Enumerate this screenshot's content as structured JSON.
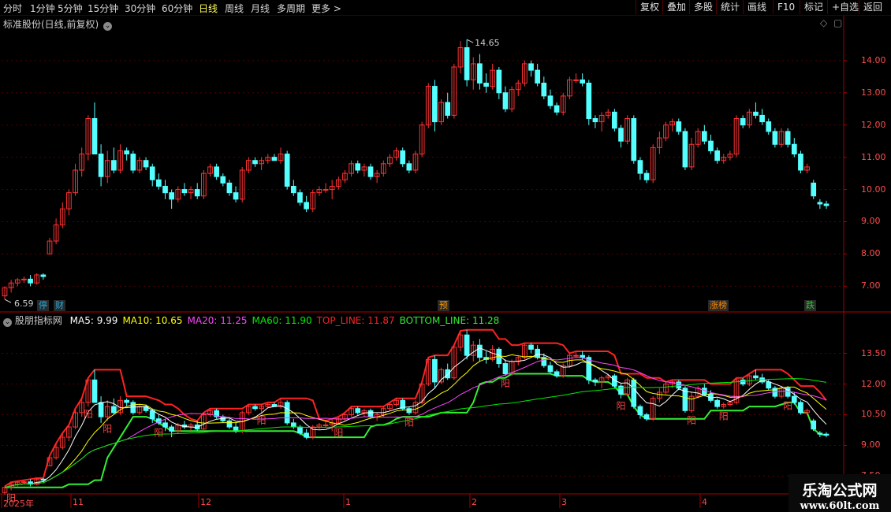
{
  "toolbar": {
    "periods": [
      "分时",
      "1分钟",
      "5分钟",
      "15分钟",
      "30分钟",
      "60分钟",
      "日线",
      "周线",
      "月线",
      "多周期",
      "更多 >"
    ],
    "active_period": "日线",
    "right_buttons": [
      "复权",
      "叠加",
      "多股",
      "统计",
      "画线",
      "F10",
      "标记",
      "+自选",
      "返回"
    ]
  },
  "main_chart": {
    "title": "标准股份(日线,前复权)",
    "high_marker": "14.65",
    "low_marker": "6.59",
    "y_ticks": [
      "14.00",
      "13.00",
      "12.00",
      "11.00",
      "10.00",
      "9.00",
      "8.00",
      "7.00"
    ],
    "events": [
      {
        "label": "停",
        "color": "#22aadd"
      },
      {
        "label": "财",
        "color": "#22aadd"
      },
      {
        "label": "预",
        "color": "#ff9900"
      },
      {
        "label": "涨榜",
        "color": "#ff8800"
      },
      {
        "label": "跌",
        "color": "#22cc22"
      }
    ]
  },
  "indicator": {
    "title": "股朋指标网",
    "values": [
      {
        "label": "MA5: 9.99",
        "color": "#ffffff"
      },
      {
        "label": "MA10: 10.65",
        "color": "#ffff00"
      },
      {
        "label": "MA20: 11.25",
        "color": "#ff44ff"
      },
      {
        "label": "MA60: 11.90",
        "color": "#00ee00"
      },
      {
        "label": "TOP_LINE: 11.87",
        "color": "#ff2222"
      },
      {
        "label": "BOTTOM_LINE: 11.28",
        "color": "#33ee33"
      }
    ],
    "y_ticks": [
      "13.50",
      "12.00",
      "10.50",
      "9.00",
      "7.50"
    ],
    "marker_text": "阳"
  },
  "x_axis": {
    "labels": [
      "2025年",
      "11",
      "12",
      "1",
      "2",
      "3",
      "4"
    ]
  },
  "watermark": {
    "name": "乐淘公式网",
    "url": "www.60lt.com"
  },
  "colors": {
    "up": "#ff3333",
    "down": "#54ffff",
    "axis": "#aa0000",
    "grid": "#550000"
  },
  "chart_data": {
    "type": "candlestick",
    "ylim": [
      6.3,
      14.9
    ],
    "candles_ohlc": [
      [
        6.7,
        7.0,
        6.59,
        6.95
      ],
      [
        6.95,
        7.2,
        6.8,
        7.1
      ],
      [
        7.1,
        7.25,
        7.0,
        7.2
      ],
      [
        7.2,
        7.3,
        7.1,
        7.22
      ],
      [
        7.22,
        7.35,
        7.0,
        7.1
      ],
      [
        7.1,
        7.4,
        7.05,
        7.35
      ],
      [
        7.35,
        7.4,
        7.2,
        7.3
      ],
      [
        8.0,
        8.5,
        8.0,
        8.4
      ],
      [
        8.4,
        9.1,
        8.3,
        8.9
      ],
      [
        8.9,
        9.6,
        8.8,
        9.4
      ],
      [
        9.4,
        10.0,
        9.2,
        9.9
      ],
      [
        9.9,
        10.8,
        9.8,
        10.6
      ],
      [
        10.6,
        11.3,
        10.4,
        11.1
      ],
      [
        11.1,
        12.3,
        10.9,
        12.2
      ],
      [
        12.2,
        12.7,
        11.1,
        11.1
      ],
      [
        11.1,
        11.4,
        10.1,
        10.4
      ],
      [
        10.4,
        11.2,
        10.2,
        10.9
      ],
      [
        10.9,
        11.3,
        10.5,
        10.6
      ],
      [
        10.6,
        11.4,
        10.5,
        11.2
      ],
      [
        11.2,
        11.3,
        10.9,
        11.1
      ],
      [
        11.1,
        11.2,
        10.5,
        10.6
      ],
      [
        10.6,
        11.0,
        10.5,
        10.9
      ],
      [
        10.9,
        11.0,
        10.6,
        10.7
      ],
      [
        10.7,
        10.8,
        10.1,
        10.3
      ],
      [
        10.3,
        10.5,
        10.0,
        10.1
      ],
      [
        10.1,
        10.3,
        9.7,
        9.9
      ],
      [
        9.9,
        10.0,
        9.4,
        9.7
      ],
      [
        9.7,
        10.1,
        9.6,
        10.0
      ],
      [
        10.0,
        10.2,
        9.8,
        9.9
      ],
      [
        9.9,
        10.1,
        9.7,
        10.0
      ],
      [
        10.0,
        10.2,
        9.7,
        9.8
      ],
      [
        9.8,
        10.6,
        9.7,
        10.5
      ],
      [
        10.5,
        10.8,
        10.4,
        10.7
      ],
      [
        10.7,
        10.8,
        10.3,
        10.4
      ],
      [
        10.4,
        10.5,
        10.1,
        10.2
      ],
      [
        10.2,
        10.3,
        9.8,
        9.9
      ],
      [
        9.9,
        10.1,
        9.6,
        9.7
      ],
      [
        9.7,
        10.7,
        9.6,
        10.6
      ],
      [
        10.6,
        11.0,
        10.5,
        10.9
      ],
      [
        10.9,
        11.0,
        10.7,
        10.8
      ],
      [
        10.8,
        11.0,
        10.6,
        10.9
      ],
      [
        10.9,
        11.1,
        10.8,
        11.0
      ],
      [
        11.0,
        11.1,
        10.9,
        10.9
      ],
      [
        10.9,
        11.3,
        10.8,
        11.1
      ],
      [
        11.1,
        11.2,
        10.0,
        10.1
      ],
      [
        10.1,
        10.3,
        9.8,
        9.9
      ],
      [
        9.9,
        10.0,
        9.5,
        9.6
      ],
      [
        9.6,
        9.8,
        9.3,
        9.4
      ],
      [
        9.4,
        10.0,
        9.3,
        9.9
      ],
      [
        9.9,
        10.1,
        9.8,
        10.0
      ],
      [
        10.0,
        10.2,
        9.9,
        10.0
      ],
      [
        10.0,
        10.3,
        9.7,
        10.1
      ],
      [
        10.1,
        10.4,
        10.0,
        10.3
      ],
      [
        10.3,
        10.6,
        10.2,
        10.5
      ],
      [
        10.5,
        10.9,
        10.4,
        10.8
      ],
      [
        10.8,
        10.9,
        10.5,
        10.6
      ],
      [
        10.6,
        10.8,
        10.4,
        10.7
      ],
      [
        10.7,
        10.8,
        10.3,
        10.4
      ],
      [
        10.4,
        10.6,
        10.2,
        10.5
      ],
      [
        10.5,
        10.9,
        10.4,
        10.8
      ],
      [
        10.8,
        11.1,
        10.7,
        11.0
      ],
      [
        11.0,
        11.3,
        10.9,
        11.2
      ],
      [
        11.2,
        11.3,
        10.7,
        10.8
      ],
      [
        10.8,
        10.9,
        10.5,
        10.6
      ],
      [
        10.6,
        11.2,
        10.5,
        11.1
      ],
      [
        11.1,
        12.1,
        11.0,
        12.0
      ],
      [
        12.0,
        13.3,
        11.9,
        13.2
      ],
      [
        13.2,
        13.4,
        11.8,
        12.1
      ],
      [
        12.1,
        12.8,
        12.0,
        12.7
      ],
      [
        12.7,
        13.0,
        12.2,
        12.3
      ],
      [
        12.3,
        13.9,
        12.2,
        13.8
      ],
      [
        13.8,
        14.6,
        13.6,
        14.4
      ],
      [
        14.4,
        14.65,
        13.2,
        13.4
      ],
      [
        13.4,
        14.1,
        13.1,
        13.9
      ],
      [
        13.9,
        14.2,
        13.1,
        13.3
      ],
      [
        13.3,
        13.6,
        13.0,
        13.2
      ],
      [
        13.2,
        13.9,
        13.1,
        13.7
      ],
      [
        13.7,
        13.8,
        12.8,
        13.0
      ],
      [
        13.0,
        13.2,
        12.4,
        12.5
      ],
      [
        12.5,
        13.2,
        12.4,
        13.1
      ],
      [
        13.1,
        13.4,
        12.9,
        13.3
      ],
      [
        13.3,
        14.0,
        13.2,
        13.9
      ],
      [
        13.9,
        14.0,
        13.5,
        13.7
      ],
      [
        13.7,
        13.9,
        13.2,
        13.3
      ],
      [
        13.3,
        13.5,
        12.8,
        12.9
      ],
      [
        12.9,
        13.1,
        12.5,
        12.6
      ],
      [
        12.6,
        12.7,
        12.3,
        12.4
      ],
      [
        12.4,
        13.0,
        12.3,
        12.9
      ],
      [
        12.9,
        13.5,
        12.8,
        13.4
      ],
      [
        13.4,
        13.6,
        13.3,
        13.4
      ],
      [
        13.4,
        13.6,
        13.2,
        13.3
      ],
      [
        13.3,
        13.4,
        12.0,
        12.2
      ],
      [
        12.2,
        12.3,
        11.9,
        12.1
      ],
      [
        12.1,
        12.4,
        11.8,
        12.3
      ],
      [
        12.3,
        12.5,
        12.2,
        12.4
      ],
      [
        12.4,
        12.5,
        11.8,
        11.9
      ],
      [
        11.9,
        12.0,
        11.3,
        11.5
      ],
      [
        11.5,
        12.3,
        11.4,
        12.2
      ],
      [
        12.2,
        12.3,
        10.8,
        10.9
      ],
      [
        10.9,
        11.0,
        10.3,
        10.5
      ],
      [
        10.5,
        10.6,
        10.2,
        10.3
      ],
      [
        10.3,
        11.4,
        10.2,
        11.3
      ],
      [
        11.3,
        11.8,
        11.1,
        11.6
      ],
      [
        11.6,
        12.1,
        11.5,
        12.0
      ],
      [
        12.0,
        12.2,
        11.8,
        12.1
      ],
      [
        12.1,
        12.2,
        11.7,
        11.8
      ],
      [
        11.8,
        11.9,
        10.6,
        10.7
      ],
      [
        10.7,
        11.6,
        10.6,
        11.4
      ],
      [
        11.4,
        11.9,
        11.3,
        11.8
      ],
      [
        11.8,
        12.0,
        11.4,
        11.5
      ],
      [
        11.5,
        11.7,
        11.1,
        11.2
      ],
      [
        11.2,
        11.3,
        10.8,
        10.9
      ],
      [
        10.9,
        11.1,
        10.8,
        11.0
      ],
      [
        11.0,
        11.2,
        10.9,
        11.1
      ],
      [
        11.1,
        12.3,
        11.0,
        12.2
      ],
      [
        12.2,
        12.3,
        11.9,
        12.0
      ],
      [
        12.0,
        12.5,
        11.9,
        12.4
      ],
      [
        12.4,
        12.7,
        12.2,
        12.3
      ],
      [
        12.3,
        12.5,
        12.0,
        12.1
      ],
      [
        12.1,
        12.2,
        11.7,
        11.8
      ],
      [
        11.8,
        11.9,
        11.3,
        11.4
      ],
      [
        11.4,
        11.9,
        11.3,
        11.8
      ],
      [
        11.8,
        11.9,
        11.3,
        11.4
      ],
      [
        11.4,
        11.6,
        11.0,
        11.1
      ],
      [
        11.1,
        11.2,
        10.5,
        10.6
      ],
      [
        10.6,
        10.8,
        10.5,
        10.7
      ],
      [
        10.2,
        10.3,
        9.7,
        9.8
      ],
      [
        9.6,
        9.7,
        9.4,
        9.55
      ],
      [
        9.55,
        9.65,
        9.4,
        9.5
      ]
    ]
  }
}
